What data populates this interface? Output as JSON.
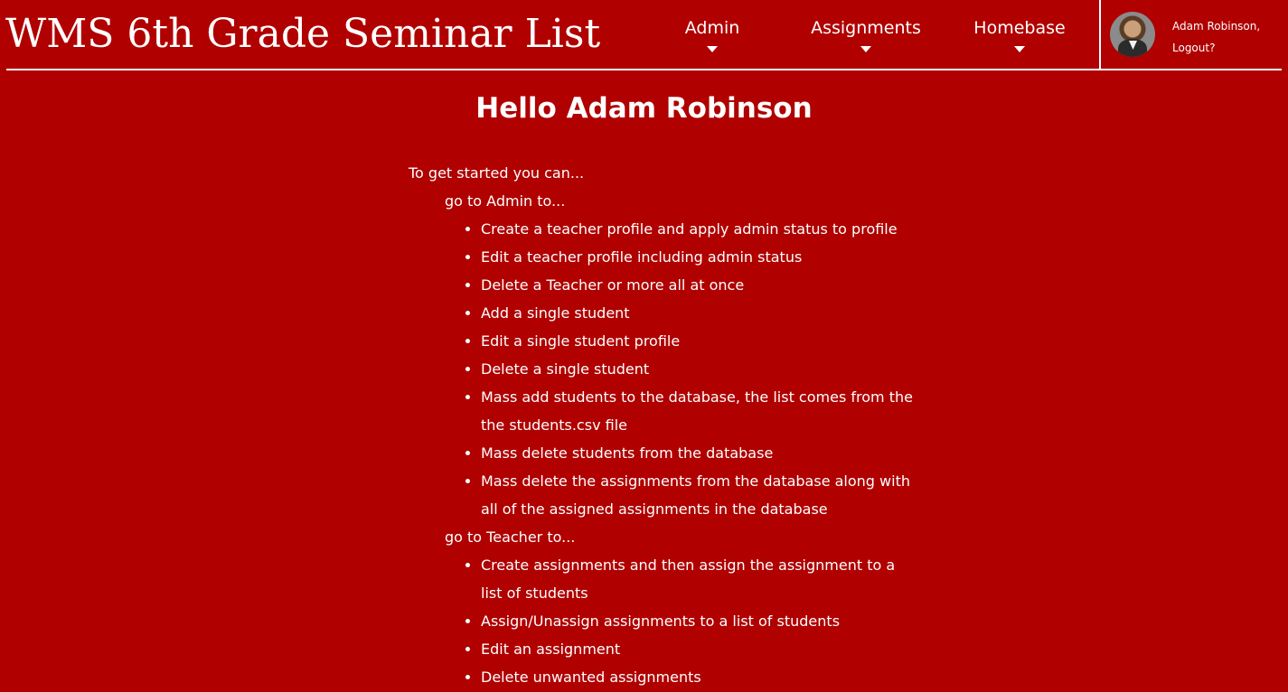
{
  "header": {
    "site_title": "WMS 6th Grade Seminar List",
    "nav": [
      {
        "label": "Admin"
      },
      {
        "label": "Assignments"
      },
      {
        "label": "Homebase"
      }
    ],
    "user": {
      "name": "Adam Robinson,",
      "logout_label": "Logout?"
    }
  },
  "main": {
    "greeting": "Hello Adam Robinson",
    "intro": "To get started you can...",
    "sections": [
      {
        "heading": "go to Admin to...",
        "items": [
          "Create a teacher profile and apply admin status to profile",
          "Edit a teacher profile including admin status",
          "Delete a Teacher or more all at once",
          "Add a single student",
          "Edit a single student profile",
          "Delete a single student",
          "Mass add students to the database, the list comes from the the students.csv file",
          "Mass delete students from the database",
          "Mass delete the assignments from the database along with all of the assigned assignments in the database"
        ]
      },
      {
        "heading": "go to Teacher to...",
        "items": [
          "Create assignments and then assign the assignment to a list of students",
          "Assign/Unassign assignments to a list of students",
          "Edit an assignment",
          "Delete unwanted assignments"
        ]
      }
    ]
  },
  "colors": {
    "background": "#b00000",
    "text": "#ffffff"
  }
}
